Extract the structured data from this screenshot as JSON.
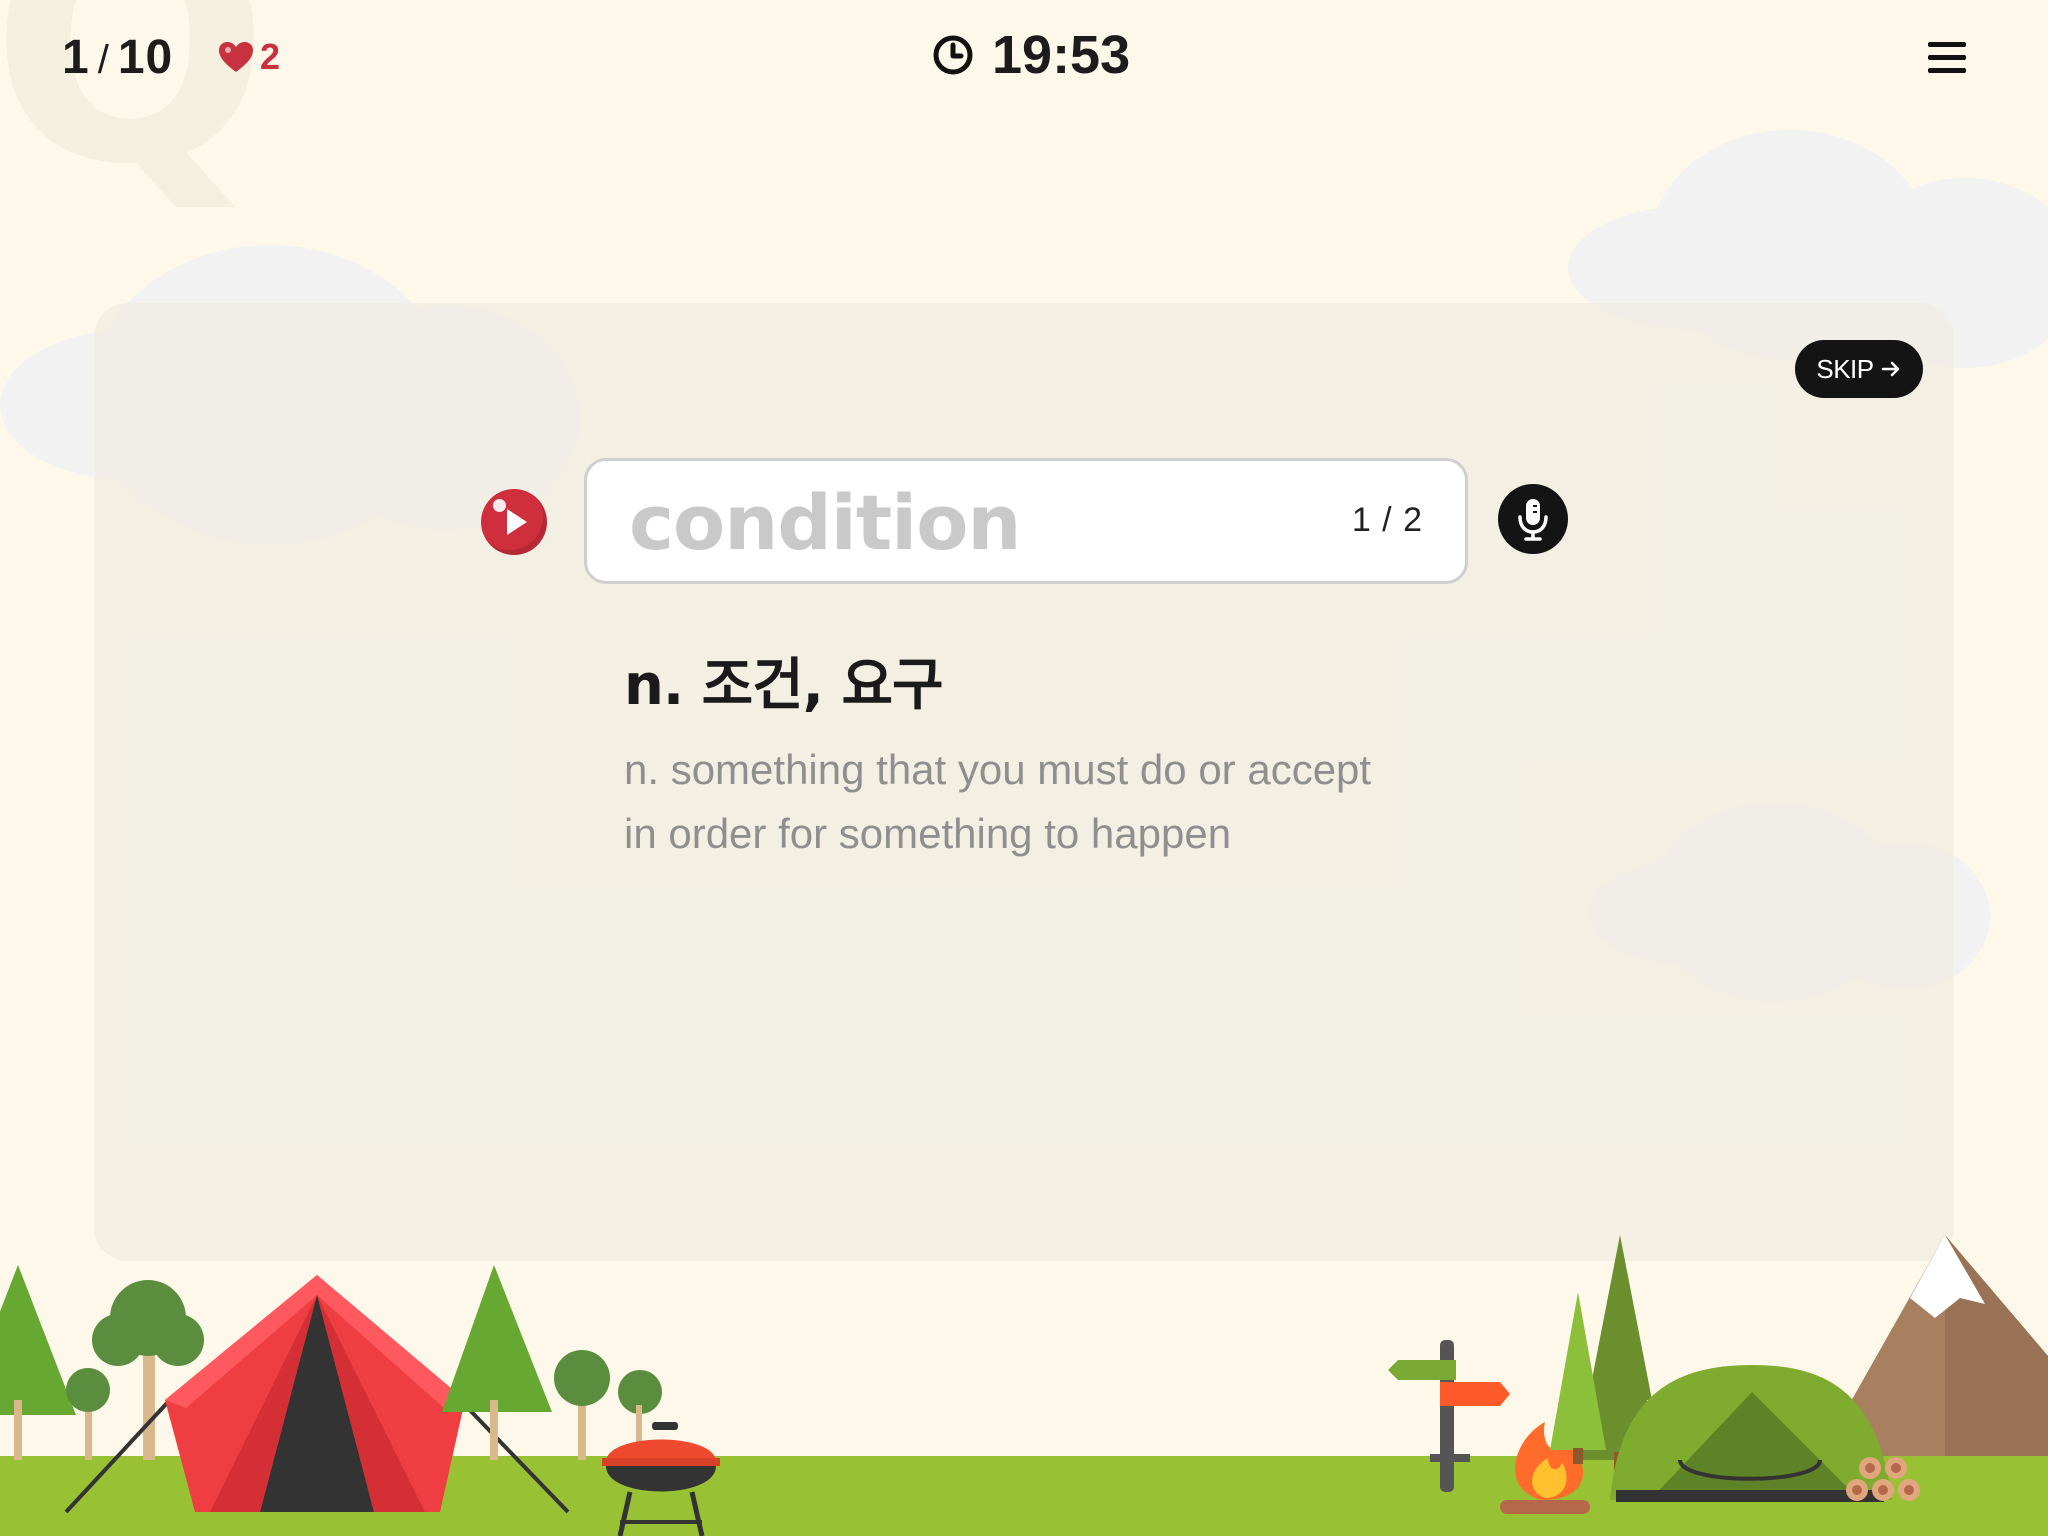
{
  "header": {
    "progress_current": "1",
    "progress_separator": "/",
    "progress_total": "10",
    "lives": "2",
    "timer": "19:53"
  },
  "card": {
    "skip_label": "SKIP",
    "answer_placeholder": "condition",
    "answer_value": "",
    "attempt": "1 / 2",
    "meaning": "n. 조건, 요구",
    "definition_line1": "n. something that you must do or accept",
    "definition_line2": "in order for something to happen"
  },
  "colors": {
    "background": "#fdf8ea",
    "card": "#eeebe1",
    "heart": "#c8323e",
    "play_button": "#cf2f3c",
    "skip_button": "#141414",
    "ground": "#98c234"
  },
  "icons": [
    "heart-icon",
    "clock-icon",
    "menu-icon",
    "arrow-right-icon",
    "play-icon",
    "microphone-icon"
  ]
}
